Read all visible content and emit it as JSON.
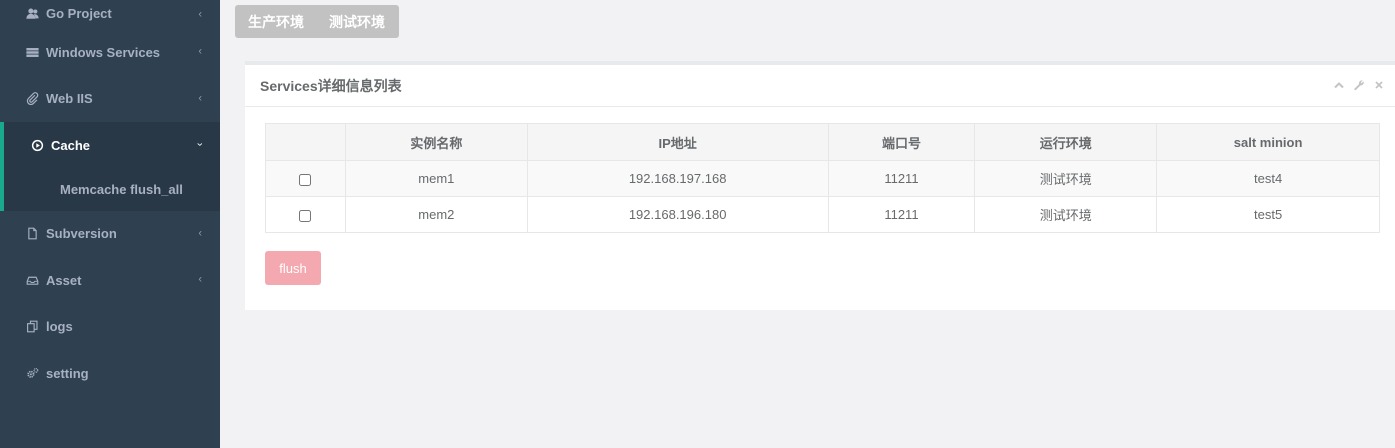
{
  "sidebar": {
    "items": [
      {
        "label": "Go Project",
        "icon": "users-icon"
      },
      {
        "label": "Windows Services",
        "icon": "list-icon"
      },
      {
        "label": "Web IIS",
        "icon": "paperclip-icon"
      },
      {
        "label": "Cache",
        "icon": "play-circle-icon",
        "active": true
      },
      {
        "label": "Subversion",
        "icon": "file-icon"
      },
      {
        "label": "Asset",
        "icon": "inbox-icon"
      },
      {
        "label": "logs",
        "icon": "copy-icon"
      },
      {
        "label": "setting",
        "icon": "cogs-icon"
      }
    ],
    "sub_items": [
      {
        "label": "Memcache flush_all"
      }
    ]
  },
  "env_tabs": [
    {
      "label": "生产环境"
    },
    {
      "label": "测试环境"
    }
  ],
  "panel": {
    "title": "Services详细信息列表",
    "tools": [
      "chevron-up-icon",
      "wrench-icon",
      "close-icon"
    ]
  },
  "table": {
    "headers": [
      "",
      "实例名称",
      "IP地址",
      "端口号",
      "运行环境",
      "salt minion"
    ],
    "rows": [
      {
        "name": "mem1",
        "ip": "192.168.197.168",
        "port": "11211",
        "env": "测试环境",
        "minion": "test4",
        "checked": false
      },
      {
        "name": "mem2",
        "ip": "192.168.196.180",
        "port": "11211",
        "env": "测试环境",
        "minion": "test5",
        "checked": false
      }
    ]
  },
  "actions": {
    "flush_label": "flush"
  },
  "colors": {
    "sidebar_bg": "#2f4050",
    "sidebar_active_bg": "#293846",
    "accent": "#19aa8d",
    "flush_button": "#f4a9b0",
    "tab_bg": "#c2c2c2"
  }
}
